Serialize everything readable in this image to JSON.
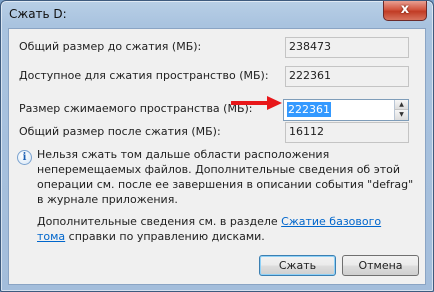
{
  "window": {
    "title": "Сжать D:"
  },
  "title_bar": {
    "close_glyph": "x"
  },
  "fields": {
    "total_before": {
      "label": "Общий размер до сжатия (МБ):",
      "value": "238473"
    },
    "available": {
      "label": "Доступное для сжатия пространство (МБ):",
      "value": "222361"
    },
    "shrink_amount": {
      "label": "Размер сжимаемого пространства (МБ):",
      "value": "222361"
    },
    "total_after": {
      "label": "Общий размер после сжатия (МБ):",
      "value": "16112"
    }
  },
  "info": {
    "icon_glyph": "i",
    "text": "Нельзя сжать том дальше области расположения неперемещаемых файлов. Дополнительные сведения об этой операции см. после ее завершения в описании события \"defrag\" в журнале приложения."
  },
  "more_info": {
    "prefix": "Дополнительные сведения см. в разделе ",
    "link": "Сжатие базового тома",
    "suffix": " справки по управлению дисками."
  },
  "buttons": {
    "shrink": "Сжать",
    "cancel": "Отмена"
  },
  "colors": {
    "arrow": "#e8171a",
    "selection": "#3399ff",
    "link": "#0066cc"
  }
}
